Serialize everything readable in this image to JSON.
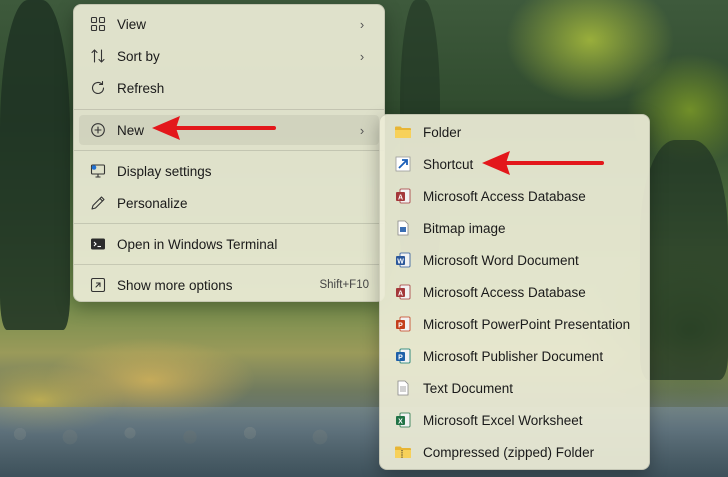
{
  "main_menu": {
    "items": [
      {
        "label": "View",
        "icon": "view-grid-icon"
      },
      {
        "label": "Sort by",
        "icon": "sort-icon"
      },
      {
        "label": "Refresh",
        "icon": "refresh-icon"
      },
      {
        "label": "New",
        "icon": "new-plus-icon"
      },
      {
        "label": "Display settings",
        "icon": "display-settings-icon"
      },
      {
        "label": "Personalize",
        "icon": "pen-icon"
      },
      {
        "label": "Open in Windows Terminal",
        "icon": "terminal-icon"
      },
      {
        "label": "Show more options",
        "icon": "show-more-icon",
        "shortcut": "Shift+F10"
      }
    ]
  },
  "new_submenu": {
    "items": [
      {
        "label": "Folder",
        "icon": "folder-icon"
      },
      {
        "label": "Shortcut",
        "icon": "shortcut-icon"
      },
      {
        "label": "Microsoft Access Database",
        "icon": "access-icon"
      },
      {
        "label": "Bitmap image",
        "icon": "bitmap-icon"
      },
      {
        "label": "Microsoft Word Document",
        "icon": "word-icon"
      },
      {
        "label": "Microsoft Access Database",
        "icon": "access-icon"
      },
      {
        "label": "Microsoft PowerPoint Presentation",
        "icon": "powerpoint-icon"
      },
      {
        "label": "Microsoft Publisher Document",
        "icon": "publisher-icon"
      },
      {
        "label": "Text Document",
        "icon": "text-document-icon"
      },
      {
        "label": "Microsoft Excel Worksheet",
        "icon": "excel-icon"
      },
      {
        "label": "Compressed (zipped) Folder",
        "icon": "zip-folder-icon"
      }
    ]
  },
  "colors": {
    "annotation_arrow": "#e3171b",
    "word": "#2b579a",
    "excel": "#217346",
    "powerpoint": "#c43e1c",
    "access": "#a4373a",
    "publisher": "#077568",
    "folder": "#f3c64b"
  }
}
